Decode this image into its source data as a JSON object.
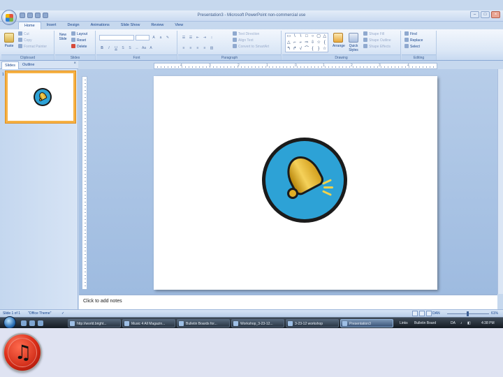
{
  "window": {
    "title": "Presentation3 - Microsoft PowerPoint non-commercial use",
    "controls": [
      "minimize-icon",
      "maximize-icon",
      "close-icon"
    ]
  },
  "ribbon": {
    "tabs": [
      "Home",
      "Insert",
      "Design",
      "Animations",
      "Slide Show",
      "Review",
      "View"
    ],
    "active_tab": "Home",
    "clipboard": {
      "label": "Clipboard",
      "paste": "Paste",
      "cut": "Cut",
      "copy": "Copy",
      "format_painter": "Format Painter"
    },
    "slides": {
      "label": "Slides",
      "new_slide": "New Slide",
      "layout": "Layout",
      "reset": "Reset",
      "delete": "Delete"
    },
    "font": {
      "label": "Font"
    },
    "paragraph": {
      "label": "Paragraph",
      "text_direction": "Text Direction",
      "align_text": "Align Text",
      "smartart": "Convert to SmartArt"
    },
    "drawing": {
      "label": "Drawing",
      "arrange": "Arrange",
      "quick_styles": "Quick Styles",
      "shape_fill": "Shape Fill",
      "shape_outline": "Shape Outline",
      "shape_effects": "Shape Effects"
    },
    "editing": {
      "label": "Editing",
      "find": "Find",
      "replace": "Replace",
      "select": "Select"
    }
  },
  "pane": {
    "tabs": [
      "Slides",
      "Outline"
    ],
    "active_tab": "Slides",
    "close": "×",
    "slide_number": "1"
  },
  "rulers": {
    "horizontal": [
      "4",
      "3",
      "2",
      "1",
      "0",
      "1",
      "2",
      "3",
      "4"
    ]
  },
  "notes": {
    "placeholder": "Click to add notes"
  },
  "status": {
    "slide_info": "Slide 1 of 1",
    "theme": "\"Office Theme\"",
    "language": "DAN",
    "zoom": "61%"
  },
  "taskbar": {
    "items": [
      "http://world.bright...",
      "Music 4 All Magazin...",
      "Bulletin Boards for...",
      "Workshop_3-23-12...",
      "3-23-12 workshop",
      "Presentation3"
    ],
    "active_item": "Presentation3",
    "tray_links": "Links",
    "tray_app": "Bulletin Board",
    "tray_lang": "DA",
    "clock": "4:38 PM"
  },
  "colors": {
    "ribbon_text": "#15428b",
    "bell_ring": "#2da2d6",
    "bell_gold": "#f5d15a",
    "thumb_border": "#f6b144",
    "badge_red": "#e0301a"
  },
  "icons": {
    "office_button": "office-logo-icon",
    "bell": "bell-icon",
    "music_badge": "music-note-icon",
    "start": "windows-start-icon"
  }
}
